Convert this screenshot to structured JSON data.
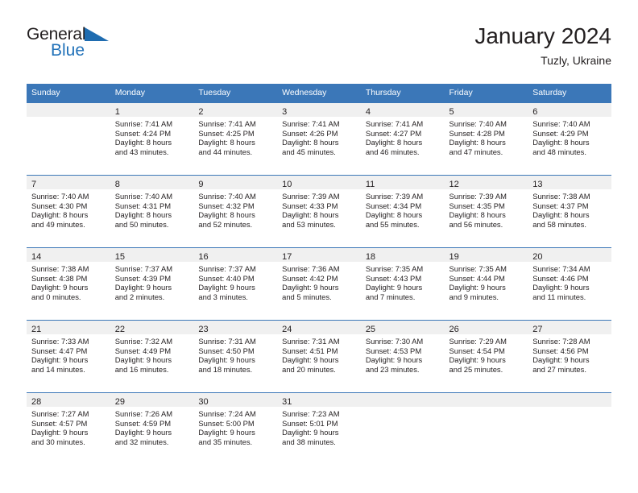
{
  "brand": {
    "name_part1": "General",
    "name_part2": "Blue",
    "triangle_color": "#1f6cb0",
    "blue_color": "#2272b9"
  },
  "header": {
    "title": "January 2024",
    "subtitle": "Tuzly, Ukraine",
    "header_bg_color": "#3b77b8",
    "daynum_band_color": "#f0f0f0"
  },
  "weekdays": [
    "Sunday",
    "Monday",
    "Tuesday",
    "Wednesday",
    "Thursday",
    "Friday",
    "Saturday"
  ],
  "weeks": [
    [
      {
        "day": "",
        "sunrise": "",
        "sunset": "",
        "daylight_line1": "",
        "daylight_line2": "",
        "empty": true
      },
      {
        "day": "1",
        "sunrise": "Sunrise: 7:41 AM",
        "sunset": "Sunset: 4:24 PM",
        "daylight_line1": "Daylight: 8 hours",
        "daylight_line2": "and 43 minutes.",
        "empty": false
      },
      {
        "day": "2",
        "sunrise": "Sunrise: 7:41 AM",
        "sunset": "Sunset: 4:25 PM",
        "daylight_line1": "Daylight: 8 hours",
        "daylight_line2": "and 44 minutes.",
        "empty": false
      },
      {
        "day": "3",
        "sunrise": "Sunrise: 7:41 AM",
        "sunset": "Sunset: 4:26 PM",
        "daylight_line1": "Daylight: 8 hours",
        "daylight_line2": "and 45 minutes.",
        "empty": false
      },
      {
        "day": "4",
        "sunrise": "Sunrise: 7:41 AM",
        "sunset": "Sunset: 4:27 PM",
        "daylight_line1": "Daylight: 8 hours",
        "daylight_line2": "and 46 minutes.",
        "empty": false
      },
      {
        "day": "5",
        "sunrise": "Sunrise: 7:40 AM",
        "sunset": "Sunset: 4:28 PM",
        "daylight_line1": "Daylight: 8 hours",
        "daylight_line2": "and 47 minutes.",
        "empty": false
      },
      {
        "day": "6",
        "sunrise": "Sunrise: 7:40 AM",
        "sunset": "Sunset: 4:29 PM",
        "daylight_line1": "Daylight: 8 hours",
        "daylight_line2": "and 48 minutes.",
        "empty": false
      }
    ],
    [
      {
        "day": "7",
        "sunrise": "Sunrise: 7:40 AM",
        "sunset": "Sunset: 4:30 PM",
        "daylight_line1": "Daylight: 8 hours",
        "daylight_line2": "and 49 minutes.",
        "empty": false
      },
      {
        "day": "8",
        "sunrise": "Sunrise: 7:40 AM",
        "sunset": "Sunset: 4:31 PM",
        "daylight_line1": "Daylight: 8 hours",
        "daylight_line2": "and 50 minutes.",
        "empty": false
      },
      {
        "day": "9",
        "sunrise": "Sunrise: 7:40 AM",
        "sunset": "Sunset: 4:32 PM",
        "daylight_line1": "Daylight: 8 hours",
        "daylight_line2": "and 52 minutes.",
        "empty": false
      },
      {
        "day": "10",
        "sunrise": "Sunrise: 7:39 AM",
        "sunset": "Sunset: 4:33 PM",
        "daylight_line1": "Daylight: 8 hours",
        "daylight_line2": "and 53 minutes.",
        "empty": false
      },
      {
        "day": "11",
        "sunrise": "Sunrise: 7:39 AM",
        "sunset": "Sunset: 4:34 PM",
        "daylight_line1": "Daylight: 8 hours",
        "daylight_line2": "and 55 minutes.",
        "empty": false
      },
      {
        "day": "12",
        "sunrise": "Sunrise: 7:39 AM",
        "sunset": "Sunset: 4:35 PM",
        "daylight_line1": "Daylight: 8 hours",
        "daylight_line2": "and 56 minutes.",
        "empty": false
      },
      {
        "day": "13",
        "sunrise": "Sunrise: 7:38 AM",
        "sunset": "Sunset: 4:37 PM",
        "daylight_line1": "Daylight: 8 hours",
        "daylight_line2": "and 58 minutes.",
        "empty": false
      }
    ],
    [
      {
        "day": "14",
        "sunrise": "Sunrise: 7:38 AM",
        "sunset": "Sunset: 4:38 PM",
        "daylight_line1": "Daylight: 9 hours",
        "daylight_line2": "and 0 minutes.",
        "empty": false
      },
      {
        "day": "15",
        "sunrise": "Sunrise: 7:37 AM",
        "sunset": "Sunset: 4:39 PM",
        "daylight_line1": "Daylight: 9 hours",
        "daylight_line2": "and 2 minutes.",
        "empty": false
      },
      {
        "day": "16",
        "sunrise": "Sunrise: 7:37 AM",
        "sunset": "Sunset: 4:40 PM",
        "daylight_line1": "Daylight: 9 hours",
        "daylight_line2": "and 3 minutes.",
        "empty": false
      },
      {
        "day": "17",
        "sunrise": "Sunrise: 7:36 AM",
        "sunset": "Sunset: 4:42 PM",
        "daylight_line1": "Daylight: 9 hours",
        "daylight_line2": "and 5 minutes.",
        "empty": false
      },
      {
        "day": "18",
        "sunrise": "Sunrise: 7:35 AM",
        "sunset": "Sunset: 4:43 PM",
        "daylight_line1": "Daylight: 9 hours",
        "daylight_line2": "and 7 minutes.",
        "empty": false
      },
      {
        "day": "19",
        "sunrise": "Sunrise: 7:35 AM",
        "sunset": "Sunset: 4:44 PM",
        "daylight_line1": "Daylight: 9 hours",
        "daylight_line2": "and 9 minutes.",
        "empty": false
      },
      {
        "day": "20",
        "sunrise": "Sunrise: 7:34 AM",
        "sunset": "Sunset: 4:46 PM",
        "daylight_line1": "Daylight: 9 hours",
        "daylight_line2": "and 11 minutes.",
        "empty": false
      }
    ],
    [
      {
        "day": "21",
        "sunrise": "Sunrise: 7:33 AM",
        "sunset": "Sunset: 4:47 PM",
        "daylight_line1": "Daylight: 9 hours",
        "daylight_line2": "and 14 minutes.",
        "empty": false
      },
      {
        "day": "22",
        "sunrise": "Sunrise: 7:32 AM",
        "sunset": "Sunset: 4:49 PM",
        "daylight_line1": "Daylight: 9 hours",
        "daylight_line2": "and 16 minutes.",
        "empty": false
      },
      {
        "day": "23",
        "sunrise": "Sunrise: 7:31 AM",
        "sunset": "Sunset: 4:50 PM",
        "daylight_line1": "Daylight: 9 hours",
        "daylight_line2": "and 18 minutes.",
        "empty": false
      },
      {
        "day": "24",
        "sunrise": "Sunrise: 7:31 AM",
        "sunset": "Sunset: 4:51 PM",
        "daylight_line1": "Daylight: 9 hours",
        "daylight_line2": "and 20 minutes.",
        "empty": false
      },
      {
        "day": "25",
        "sunrise": "Sunrise: 7:30 AM",
        "sunset": "Sunset: 4:53 PM",
        "daylight_line1": "Daylight: 9 hours",
        "daylight_line2": "and 23 minutes.",
        "empty": false
      },
      {
        "day": "26",
        "sunrise": "Sunrise: 7:29 AM",
        "sunset": "Sunset: 4:54 PM",
        "daylight_line1": "Daylight: 9 hours",
        "daylight_line2": "and 25 minutes.",
        "empty": false
      },
      {
        "day": "27",
        "sunrise": "Sunrise: 7:28 AM",
        "sunset": "Sunset: 4:56 PM",
        "daylight_line1": "Daylight: 9 hours",
        "daylight_line2": "and 27 minutes.",
        "empty": false
      }
    ],
    [
      {
        "day": "28",
        "sunrise": "Sunrise: 7:27 AM",
        "sunset": "Sunset: 4:57 PM",
        "daylight_line1": "Daylight: 9 hours",
        "daylight_line2": "and 30 minutes.",
        "empty": false
      },
      {
        "day": "29",
        "sunrise": "Sunrise: 7:26 AM",
        "sunset": "Sunset: 4:59 PM",
        "daylight_line1": "Daylight: 9 hours",
        "daylight_line2": "and 32 minutes.",
        "empty": false
      },
      {
        "day": "30",
        "sunrise": "Sunrise: 7:24 AM",
        "sunset": "Sunset: 5:00 PM",
        "daylight_line1": "Daylight: 9 hours",
        "daylight_line2": "and 35 minutes.",
        "empty": false
      },
      {
        "day": "31",
        "sunrise": "Sunrise: 7:23 AM",
        "sunset": "Sunset: 5:01 PM",
        "daylight_line1": "Daylight: 9 hours",
        "daylight_line2": "and 38 minutes.",
        "empty": false
      },
      {
        "day": "",
        "sunrise": "",
        "sunset": "",
        "daylight_line1": "",
        "daylight_line2": "",
        "empty": true
      },
      {
        "day": "",
        "sunrise": "",
        "sunset": "",
        "daylight_line1": "",
        "daylight_line2": "",
        "empty": true
      },
      {
        "day": "",
        "sunrise": "",
        "sunset": "",
        "daylight_line1": "",
        "daylight_line2": "",
        "empty": true
      }
    ]
  ]
}
